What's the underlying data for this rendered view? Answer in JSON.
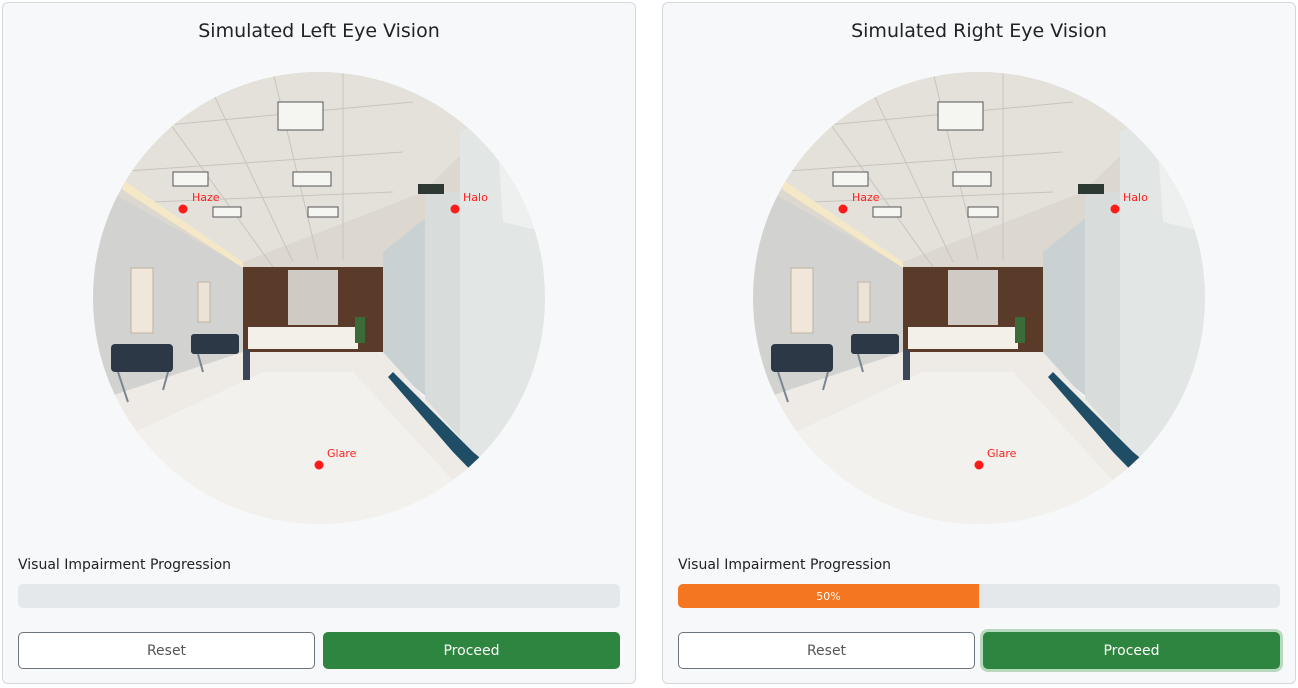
{
  "panels": [
    {
      "title": "Simulated Left Eye Vision",
      "markers": [
        {
          "label": "Haze"
        },
        {
          "label": "Halo"
        },
        {
          "label": "Glare"
        }
      ],
      "progress": {
        "label": "Visual Impairment Progression",
        "percent": 0,
        "text": ""
      },
      "reset_label": "Reset",
      "proceed_label": "Proceed"
    },
    {
      "title": "Simulated Right Eye Vision",
      "markers": [
        {
          "label": "Haze"
        },
        {
          "label": "Halo"
        },
        {
          "label": "Glare"
        }
      ],
      "progress": {
        "label": "Visual Impairment Progression",
        "percent": 50,
        "text": "50%"
      },
      "reset_label": "Reset",
      "proceed_label": "Proceed"
    }
  ],
  "colors": {
    "progress_fill": "#f47621",
    "proceed_button": "#2e8540",
    "marker": "#ff1a1a"
  }
}
